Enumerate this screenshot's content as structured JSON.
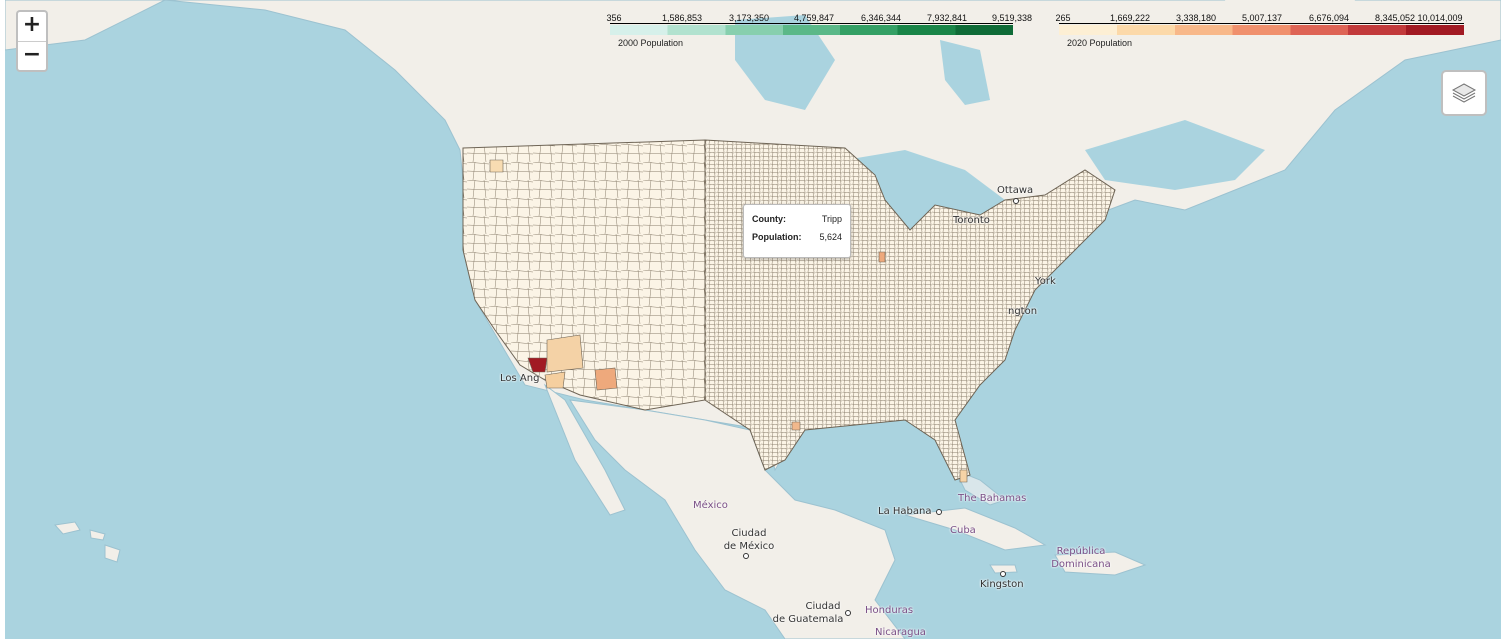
{
  "zoom": {
    "in_label": "+",
    "out_label": "−"
  },
  "legends": [
    {
      "caption": "2000 Population",
      "ticks": [
        "356",
        "1,586,853",
        "3,173,350",
        "4,759,847",
        "6,346,344",
        "7,932,841",
        "9,519,338"
      ],
      "color_stops": [
        "#d6f0ea",
        "#b2e2cf",
        "#87cfae",
        "#5bb888",
        "#35a065",
        "#1a8548",
        "#0f6b37"
      ]
    },
    {
      "caption": "2020 Population",
      "ticks": [
        "265",
        "1,669,222",
        "3,338,180",
        "5,007,137",
        "6,676,094",
        "8,345,052",
        "10,014,009"
      ],
      "color_stops": [
        "#fdefd4",
        "#fcd9a9",
        "#f8b889",
        "#f0906d",
        "#de6455",
        "#c23a3b",
        "#a11a23"
      ]
    }
  ],
  "tooltip": {
    "county_key": "County:",
    "county_value": "Tripp",
    "population_key": "Population:",
    "population_value": "5,624"
  },
  "places": {
    "ottawa": "Ottawa",
    "toronto": "Toronto",
    "new_york": "York",
    "washington": "ngton",
    "los_angeles": "Los Ang",
    "mexico": "México",
    "ciudad_mexico_1": "Ciudad",
    "ciudad_mexico_2": "de México",
    "la_habana": "La Habana",
    "cuba": "Cuba",
    "bahamas": "The Bahamas",
    "republica_1": "República",
    "republica_2": "Dominicana",
    "kingston": "Kingston",
    "guatemala_1": "Ciudad",
    "guatemala_2": "de Guatemala",
    "honduras": "Honduras",
    "nicaragua": "Nicaragua"
  },
  "colors": {
    "water": "#aad3df",
    "land": "#f2efe9",
    "county_fill": "#fbf4e6",
    "county_line": "#6e6455"
  }
}
